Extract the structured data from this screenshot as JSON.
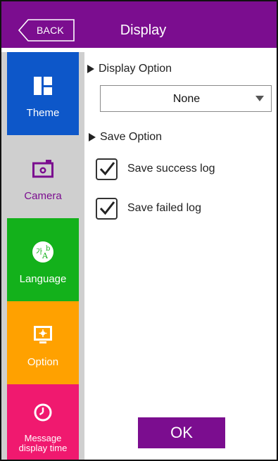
{
  "header": {
    "back_label": "BACK",
    "title": "Display",
    "color": "#7b0d8f"
  },
  "sidebar": {
    "items": [
      {
        "label": "Theme",
        "icon": "theme-icon",
        "color": "#0d57c9"
      },
      {
        "label": "Camera",
        "icon": "camera-icon",
        "color": "#cfcfcf",
        "selected": true
      },
      {
        "label": "Language",
        "icon": "language-icon",
        "color": "#13b11b"
      },
      {
        "label": "Option",
        "icon": "option-icon",
        "color": "#ffa100"
      },
      {
        "label_line1": "Message",
        "label_line2": "display time",
        "icon": "clock-icon",
        "color": "#f0196f"
      }
    ]
  },
  "content": {
    "display_option": {
      "heading": "Display Option",
      "selected": "None"
    },
    "save_option": {
      "heading": "Save Option",
      "items": [
        {
          "label": "Save success log",
          "checked": true
        },
        {
          "label": "Save failed log",
          "checked": true
        }
      ]
    },
    "ok_label": "OK"
  }
}
